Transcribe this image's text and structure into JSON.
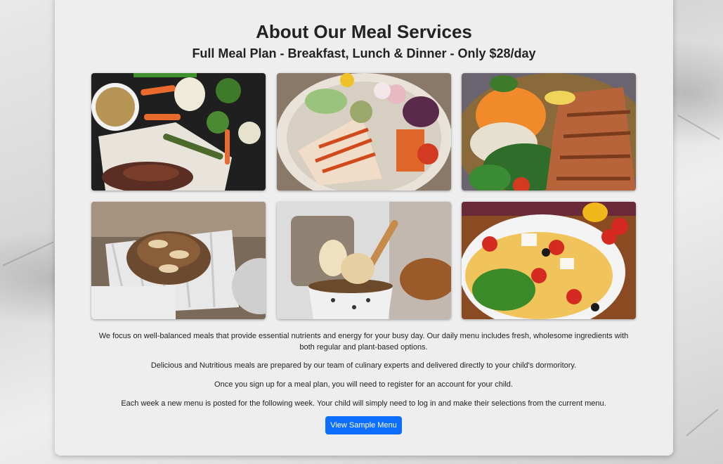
{
  "title": "About Our Meal Services",
  "subtitle": "Full Meal Plan - Breakfast, Lunch & Dinner - Only $28/day",
  "paragraphs": [
    "We focus on well-balanced meals that provide essential nutrients and energy for your busy day. Our daily menu includes fresh, wholesome ingredients with both regular and plant-based options.",
    "Delicious and Nutritious meals are prepared by our team of culinary experts and delivered directly to your child's dormoritory.",
    "Once you sign up for a meal plan, you will need to register for an account for your child.",
    "Each week a new menu is posted for the following week. Your child will simply need to log in and make their selections from the current menu."
  ],
  "button_label": "View Sample Menu",
  "colors": {
    "button": "#0d6efd",
    "card": "#eeeeee"
  },
  "photos": [
    "steak-vegetables-photo",
    "chicken-salad-bowl-photo",
    "grilled-chicken-salad-photo",
    "almond-muffins-photo",
    "yogurt-parfait-photo",
    "omelette-photo"
  ]
}
